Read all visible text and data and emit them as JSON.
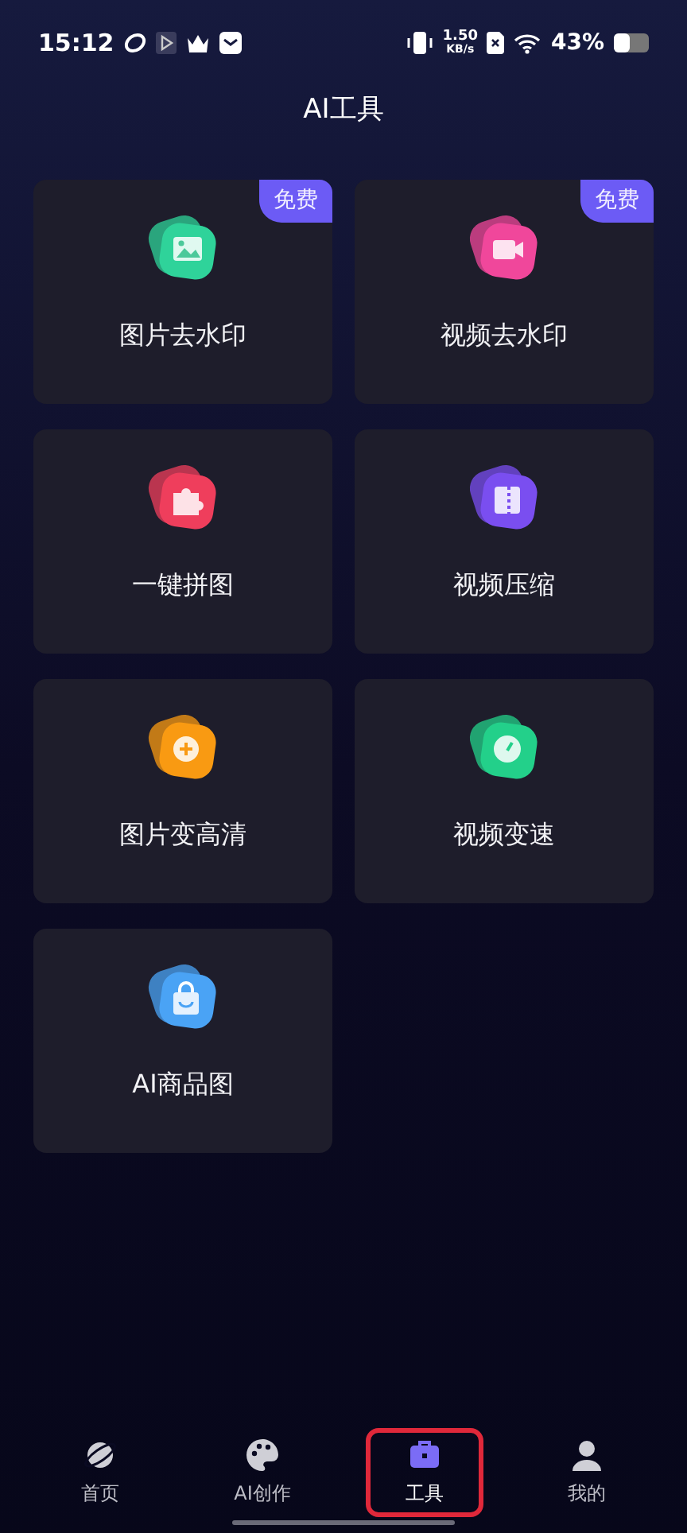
{
  "status_bar": {
    "time": "15:12",
    "speed_value": "1.50",
    "speed_unit": "KB/s",
    "battery": "43%"
  },
  "title": "AI工具",
  "tools": [
    {
      "label": "图片去水印",
      "kind": "image",
      "color": "#2fd39a",
      "badge": "免费"
    },
    {
      "label": "视频去水印",
      "kind": "video",
      "color": "#f0479b",
      "badge": "免费"
    },
    {
      "label": "一键拼图",
      "kind": "puzzle",
      "color": "#ef3e5c"
    },
    {
      "label": "视频压缩",
      "kind": "zip",
      "color": "#7a4ef0"
    },
    {
      "label": "图片变高清",
      "kind": "enhance",
      "color": "#f99a12"
    },
    {
      "label": "视频变速",
      "kind": "speed",
      "color": "#23d08a"
    },
    {
      "label": "AI商品图",
      "kind": "bag",
      "color": "#4aa3f5"
    }
  ],
  "tabs": [
    {
      "label": "首页",
      "kind": "planet",
      "selected": false,
      "highlighted": false
    },
    {
      "label": "AI创作",
      "kind": "palette",
      "selected": false,
      "highlighted": false
    },
    {
      "label": "工具",
      "kind": "toolbox",
      "selected": true,
      "highlighted": true
    },
    {
      "label": "我的",
      "kind": "person",
      "selected": false,
      "highlighted": false
    }
  ]
}
